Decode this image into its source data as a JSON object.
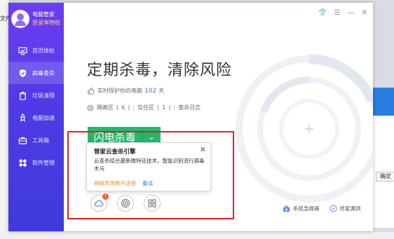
{
  "background": {
    "menu_fragment": "文件",
    "dialog_button": "确定"
  },
  "sidebar": {
    "profile_name": "电脑管家",
    "profile_link": "登录享特权",
    "items": [
      {
        "label": "首页体检",
        "icon": "monitor-icon"
      },
      {
        "label": "病毒查杀",
        "icon": "shield-icon"
      },
      {
        "label": "垃圾清理",
        "icon": "trash-icon"
      },
      {
        "label": "电脑加速",
        "icon": "rocket-icon"
      },
      {
        "label": "工具箱",
        "icon": "toolbox-icon"
      },
      {
        "label": "软件管理",
        "icon": "apps-icon"
      }
    ],
    "active_index": 1
  },
  "titlebar": {
    "skin": "👕",
    "menu": "☰",
    "minimize": "—",
    "close": "✕"
  },
  "main": {
    "headline": "定期杀毒，清除风险",
    "protect_prefix": "实时保护你的电脑",
    "protect_days": "102",
    "protect_unit": "天",
    "quarantine_label": "隔离区",
    "quarantine_count": "6",
    "trusted_label": "信任区",
    "trusted_count": "1",
    "log_label": "查杀日志",
    "scan_button": "闪电杀毒",
    "scan_dropdown": "⌄"
  },
  "popup": {
    "title": "管家云查杀引擎",
    "close": "✕",
    "description": "云查杀结合最新微特征技术，智能识别流行病毒木马",
    "warning": "网络异常断开连接",
    "retry": "重试"
  },
  "engines": [
    {
      "icon": "cloud-engine-icon",
      "badge": "!"
    },
    {
      "icon": "target-engine-icon"
    },
    {
      "icon": "grid-engine-icon"
    }
  ],
  "bottom": {
    "emergency_box": "系统急救箱",
    "repair": "修复漏洞"
  },
  "colors": {
    "sidebar_top": "#6d3cf2",
    "sidebar_bottom": "#3f39dc",
    "scan_green": "#22b96a",
    "link_blue": "#3d6fd9",
    "warn_orange": "#f08a1c",
    "highlight_red": "#e21f1f"
  }
}
